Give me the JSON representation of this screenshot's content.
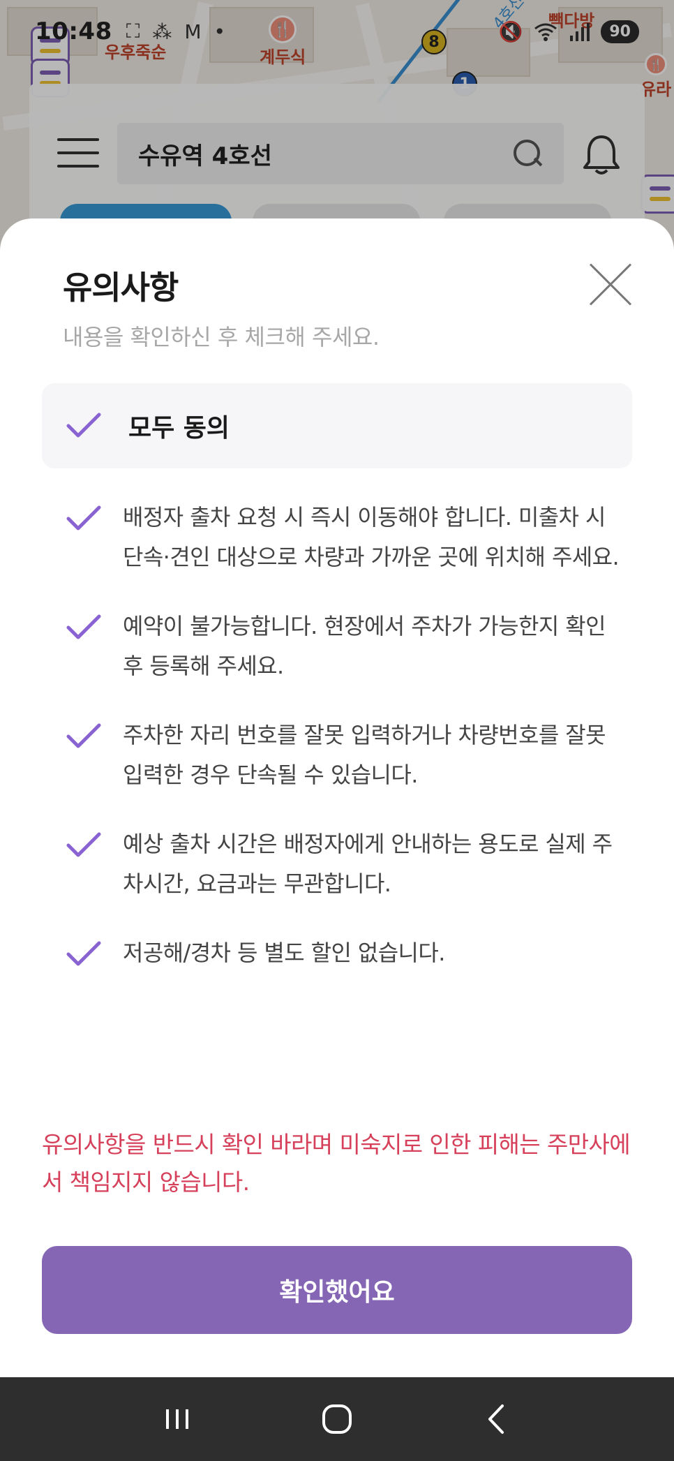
{
  "status_bar": {
    "time": "10:48",
    "battery": "90",
    "left_icons": [
      "screenshot-icon",
      "app-icon",
      "gmail-icon",
      "dot-icon"
    ],
    "right_icons": [
      "mute-icon",
      "wifi-icon",
      "signal-icon"
    ]
  },
  "map": {
    "pois": [
      {
        "label": "계두식",
        "icon": "restaurant-icon"
      },
      {
        "label": "우후죽순",
        "icon": "restaurant-icon"
      },
      {
        "label": "빽다방",
        "icon": "cafe-icon"
      },
      {
        "label": "유라",
        "icon": "restaurant-icon"
      }
    ],
    "line_badges": [
      "8",
      "1"
    ],
    "road_label": "4호선"
  },
  "app_bar": {
    "search_value": "수유역 4호선",
    "menu_icon": "hamburger-icon",
    "search_icon": "search-icon",
    "bell_icon": "bell-icon"
  },
  "sheet": {
    "title": "유의사항",
    "subtitle": "내용을 확인하신 후 체크해 주세요.",
    "agree_all_label": "모두 동의",
    "terms": [
      {
        "text": "배정자 출차 요청 시 즉시 이동해야 합니다. 미출차 시 단속·견인 대상으로 차량과 가까운 곳에 위치해 주세요.",
        "checked": true
      },
      {
        "text": "예약이 불가능합니다. 현장에서 주차가 가능한지 확인 후 등록해 주세요.",
        "checked": true
      },
      {
        "text": "주차한 자리 번호를 잘못 입력하거나 차량번호를 잘못 입력한 경우 단속될 수 있습니다.",
        "checked": true
      },
      {
        "text": "예상 출차 시간은 배정자에게 안내하는 용도로 실제 주차시간, 요금과는 무관합니다.",
        "checked": true
      },
      {
        "text": "저공해/경차 등 별도 할인 없습니다.",
        "checked": true
      }
    ],
    "notice": "유의사항을 반드시 확인 바라며 미숙지로 인한 피해는 주만사에서 책임지지 않습니다.",
    "confirm_label": "확인했어요"
  },
  "colors": {
    "accent": "#8466b5",
    "check": "#8a63d2",
    "notice": "#d6405a"
  },
  "nav_bar": {
    "buttons": [
      "recent-apps-icon",
      "home-icon",
      "back-icon"
    ]
  }
}
